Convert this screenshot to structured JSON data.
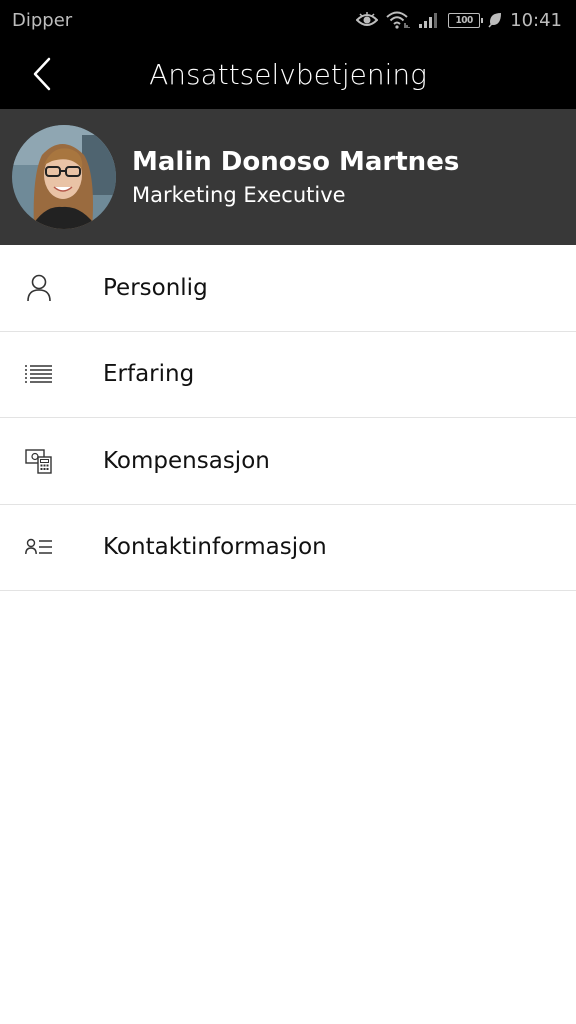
{
  "status_bar": {
    "carrier": "Dipper",
    "battery": "100",
    "time": "10:41",
    "icons": [
      "eye-icon",
      "wifi-icon",
      "signal-icon",
      "battery-icon",
      "leaf-icon"
    ]
  },
  "app_bar": {
    "title": "Ansattselvbetjening",
    "back_icon": "chevron-left-icon"
  },
  "profile": {
    "name": "Malin Donoso Martnes",
    "role": "Marketing Executive"
  },
  "menu": {
    "items": [
      {
        "label": "Personlig",
        "icon": "person-icon"
      },
      {
        "label": "Erfaring",
        "icon": "list-icon"
      },
      {
        "label": "Kompensasjon",
        "icon": "money-calculator-icon"
      },
      {
        "label": "Kontaktinformasjon",
        "icon": "contact-card-icon"
      }
    ]
  },
  "colors": {
    "app_bar": "#000000",
    "profile_bg": "#383838",
    "divider": "#e3e3e3",
    "text": "#111111"
  }
}
